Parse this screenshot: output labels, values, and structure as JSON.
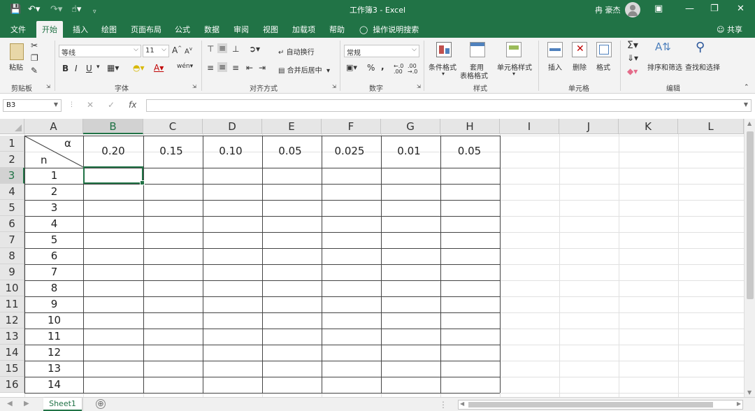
{
  "titlebar": {
    "save_icon": "save-icon",
    "undo_icon": "undo-icon",
    "redo_icon": "redo-icon",
    "touch_icon": "touch-mode-icon",
    "title": "工作簿3 - Excel",
    "user_name": "冉 豪杰",
    "window_buttons": [
      "ribbon-display-icon",
      "minimize-icon",
      "restore-icon",
      "close-icon"
    ]
  },
  "tabs": {
    "items": [
      "文件",
      "开始",
      "插入",
      "绘图",
      "页面布局",
      "公式",
      "数据",
      "审阅",
      "视图",
      "加载项",
      "帮助"
    ],
    "active": "开始",
    "tell_me": "操作说明搜索",
    "share": "共享"
  },
  "ribbon": {
    "clipboard": {
      "paste": "粘贴",
      "label": "剪贴板"
    },
    "font": {
      "name": "等线",
      "size": "11",
      "label": "字体",
      "bold": "B",
      "italic": "I",
      "underline": "U",
      "grow": "A",
      "shrink": "A",
      "wen": "wén"
    },
    "alignment": {
      "wrap": "自动换行",
      "merge": "合并后居中",
      "label": "对齐方式"
    },
    "number": {
      "format": "常规",
      "label": "数字",
      "percent": "%",
      "comma": ","
    },
    "styles": {
      "conditional": "条件格式",
      "table_line1": "套用",
      "table_line2": "表格格式",
      "cell_styles": "单元格样式",
      "label": "样式"
    },
    "cells": {
      "insert": "插入",
      "delete": "删除",
      "format": "格式",
      "label": "单元格"
    },
    "editing": {
      "sort": "排序和筛选",
      "find": "查找和选择",
      "label": "编辑"
    }
  },
  "formula_bar": {
    "name_box": "B3",
    "fx": "fx",
    "cancel": "✕",
    "enter": "✓",
    "value": ""
  },
  "sheet": {
    "columns": [
      "A",
      "B",
      "C",
      "D",
      "E",
      "F",
      "G",
      "H",
      "I",
      "J",
      "K",
      "L"
    ],
    "selected_column": "B",
    "rows": [
      "1",
      "2",
      "3",
      "4",
      "5",
      "6",
      "7",
      "8",
      "9",
      "10",
      "11",
      "12",
      "13",
      "14",
      "15",
      "16"
    ],
    "selected_row": "3",
    "corner_alpha": "α",
    "corner_n": "n",
    "alpha_values": [
      "0.20",
      "0.15",
      "0.10",
      "0.05",
      "0.025",
      "0.01",
      "0.05"
    ],
    "n_values": [
      "1",
      "2",
      "3",
      "4",
      "5",
      "6",
      "7",
      "8",
      "9",
      "10",
      "11",
      "12",
      "13",
      "14"
    ],
    "active_cell": "B3"
  },
  "statusbar": {
    "sheet_tab": "Sheet1",
    "add_sheet": "⊕"
  }
}
